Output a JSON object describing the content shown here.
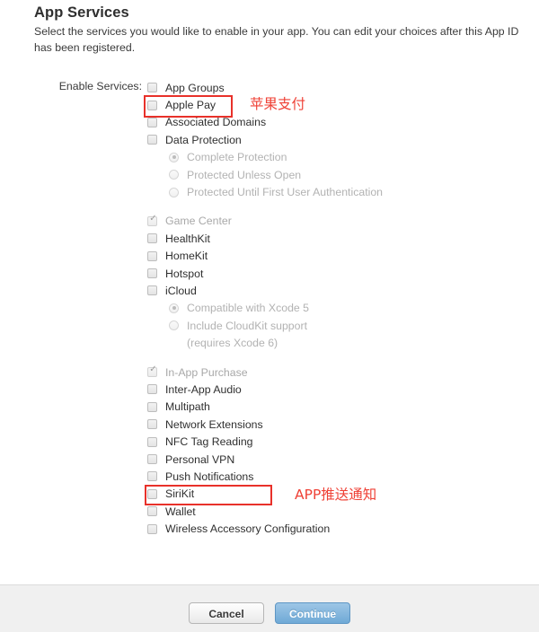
{
  "header": {
    "title": "App Services",
    "description": "Select the services you would like to enable in your app. You can edit your choices after this App ID has been registered."
  },
  "form": {
    "field_label": "Enable Services:",
    "services": [
      {
        "label": "App Groups",
        "checked": false,
        "disabled": false
      },
      {
        "label": "Apple Pay",
        "checked": false,
        "disabled": false
      },
      {
        "label": "Associated Domains",
        "checked": false,
        "disabled": false
      },
      {
        "label": "Data Protection",
        "checked": false,
        "disabled": false
      }
    ],
    "data_protection_options": [
      {
        "label": "Complete Protection",
        "selected": true
      },
      {
        "label": "Protected Unless Open",
        "selected": false
      },
      {
        "label": "Protected Until First User Authentication",
        "selected": false
      }
    ],
    "services_group2": [
      {
        "label": "Game Center",
        "checked": true,
        "disabled": true
      },
      {
        "label": "HealthKit",
        "checked": false,
        "disabled": false
      },
      {
        "label": "HomeKit",
        "checked": false,
        "disabled": false
      },
      {
        "label": "Hotspot",
        "checked": false,
        "disabled": false
      },
      {
        "label": "iCloud",
        "checked": false,
        "disabled": false
      }
    ],
    "icloud_options": [
      {
        "label": "Compatible with Xcode 5",
        "selected": true
      },
      {
        "label": "Include CloudKit support",
        "selected": false
      }
    ],
    "icloud_option_continuation": "(requires Xcode 6)",
    "services_group3": [
      {
        "label": "In-App Purchase",
        "checked": true,
        "disabled": true
      },
      {
        "label": "Inter-App Audio",
        "checked": false,
        "disabled": false
      },
      {
        "label": "Multipath",
        "checked": false,
        "disabled": false
      },
      {
        "label": "Network Extensions",
        "checked": false,
        "disabled": false
      },
      {
        "label": "NFC Tag Reading",
        "checked": false,
        "disabled": false
      },
      {
        "label": "Personal VPN",
        "checked": false,
        "disabled": false
      },
      {
        "label": "Push Notifications",
        "checked": false,
        "disabled": false
      },
      {
        "label": "SiriKit",
        "checked": false,
        "disabled": false
      },
      {
        "label": "Wallet",
        "checked": false,
        "disabled": false
      },
      {
        "label": "Wireless Accessory Configuration",
        "checked": false,
        "disabled": false
      }
    ]
  },
  "annotations": {
    "apple_pay_note": "苹果支付",
    "push_note": "APP推送通知",
    "highlight_color": "#e8312a",
    "text_color": "#ef4136"
  },
  "footer": {
    "cancel_label": "Cancel",
    "continue_label": "Continue",
    "continue_color": "#7fb0d8"
  }
}
